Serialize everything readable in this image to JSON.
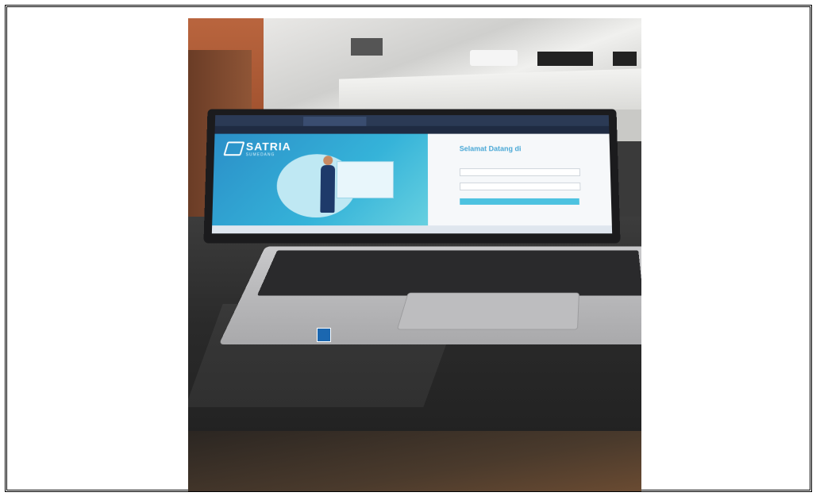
{
  "scene": {
    "description_label": "Photograph of a laptop on a dark table showing a login page"
  },
  "laptop_screen": {
    "brand": "SATRIA",
    "brand_sub": "SUMEDANG",
    "welcome": "Selamat Datang di",
    "colors": {
      "left_pane": "#35b3d9",
      "accent": "#4aa8d6",
      "login_button": "#4dc2e0"
    }
  }
}
